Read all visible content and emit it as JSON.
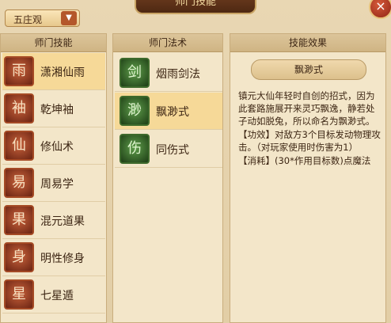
{
  "window": {
    "title": "师门技能",
    "close_icon": "×"
  },
  "sect_selector": {
    "value": "五庄观",
    "arrow": "▼"
  },
  "skills_panel": {
    "header": "师门技能",
    "items": [
      {
        "label": "潇湘仙雨",
        "icon": "雨",
        "selected": true
      },
      {
        "label": "乾坤袖",
        "icon": "袖"
      },
      {
        "label": "修仙术",
        "icon": "仙"
      },
      {
        "label": "周易学",
        "icon": "易"
      },
      {
        "label": "混元道果",
        "icon": "果"
      },
      {
        "label": "明性修身",
        "icon": "身"
      },
      {
        "label": "七星遁",
        "icon": "星"
      }
    ]
  },
  "spells_panel": {
    "header": "师门法术",
    "items": [
      {
        "label": "烟雨剑法",
        "icon": "剑"
      },
      {
        "label": "飘渺式",
        "icon": "渺",
        "selected": true
      },
      {
        "label": "同伤式",
        "icon": "伤"
      }
    ]
  },
  "effect_panel": {
    "header": "技能效果",
    "spell_name": "飘渺式",
    "description": "镇元大仙年轻时自创的招式，因为此套路施展开来灵巧飘逸，静若处子动如脱兔，所以命名为飘渺式。",
    "effect": "【功效】对敌方3个目标发动物理攻击。（对玩家使用时伤害为1）",
    "cost": "【消耗】(30*作用目标数)点魔法"
  }
}
